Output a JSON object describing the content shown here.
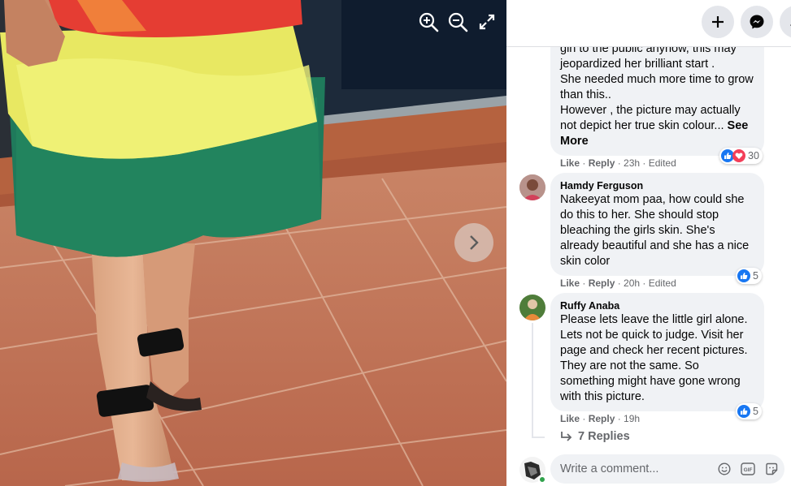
{
  "viewer": {
    "zoom_in_icon": "zoom-in-icon",
    "zoom_out_icon": "zoom-out-icon",
    "fullscreen_icon": "expand-icon",
    "next_icon": "chevron-right-icon"
  },
  "topbar": {
    "create_icon": "plus-icon",
    "messenger_icon": "messenger-icon",
    "notifications_icon": "bell-icon"
  },
  "comments": [
    {
      "author": "",
      "text_top": "gin to the public anyhow, this may",
      "text": "jeopardized her brilliant start .\nShe needed much more time to grow than this..\nHowever , the picture may actually not depict her true skin colour...",
      "see_more": "See More",
      "like": "Like",
      "reply": "Reply",
      "time": "23h",
      "edited": "Edited",
      "reaction_count": "30",
      "reactions": [
        "like",
        "love"
      ]
    },
    {
      "author": "Hamdy Ferguson",
      "text": "Nakeeyat mom paa, how could she do this to her. She should stop bleaching the girls skin. She's already beautiful and she has a nice skin color",
      "like": "Like",
      "reply": "Reply",
      "time": "20h",
      "edited": "Edited",
      "reaction_count": "5",
      "reactions": [
        "like"
      ]
    },
    {
      "author": "Ruffy Anaba",
      "text": "Please lets leave the little girl alone. Lets not be quick to judge. Visit her page and check her recent pictures. They are not the same. So something might have gone wrong with this picture.",
      "like": "Like",
      "reply": "Reply",
      "time": "19h",
      "reaction_count": "5",
      "reactions": [
        "like"
      ],
      "replies_label": "7 Replies"
    }
  ],
  "composer": {
    "placeholder": "Write a comment...",
    "emoji_icon": "smiley-icon",
    "gif_icon": "gif-icon",
    "sticker_icon": "sticker-icon"
  },
  "colors": {
    "like_blue": "#1877f2",
    "love_red": "#f33e58",
    "bubble_bg": "#f0f2f5",
    "meta_gray": "#65676b"
  }
}
